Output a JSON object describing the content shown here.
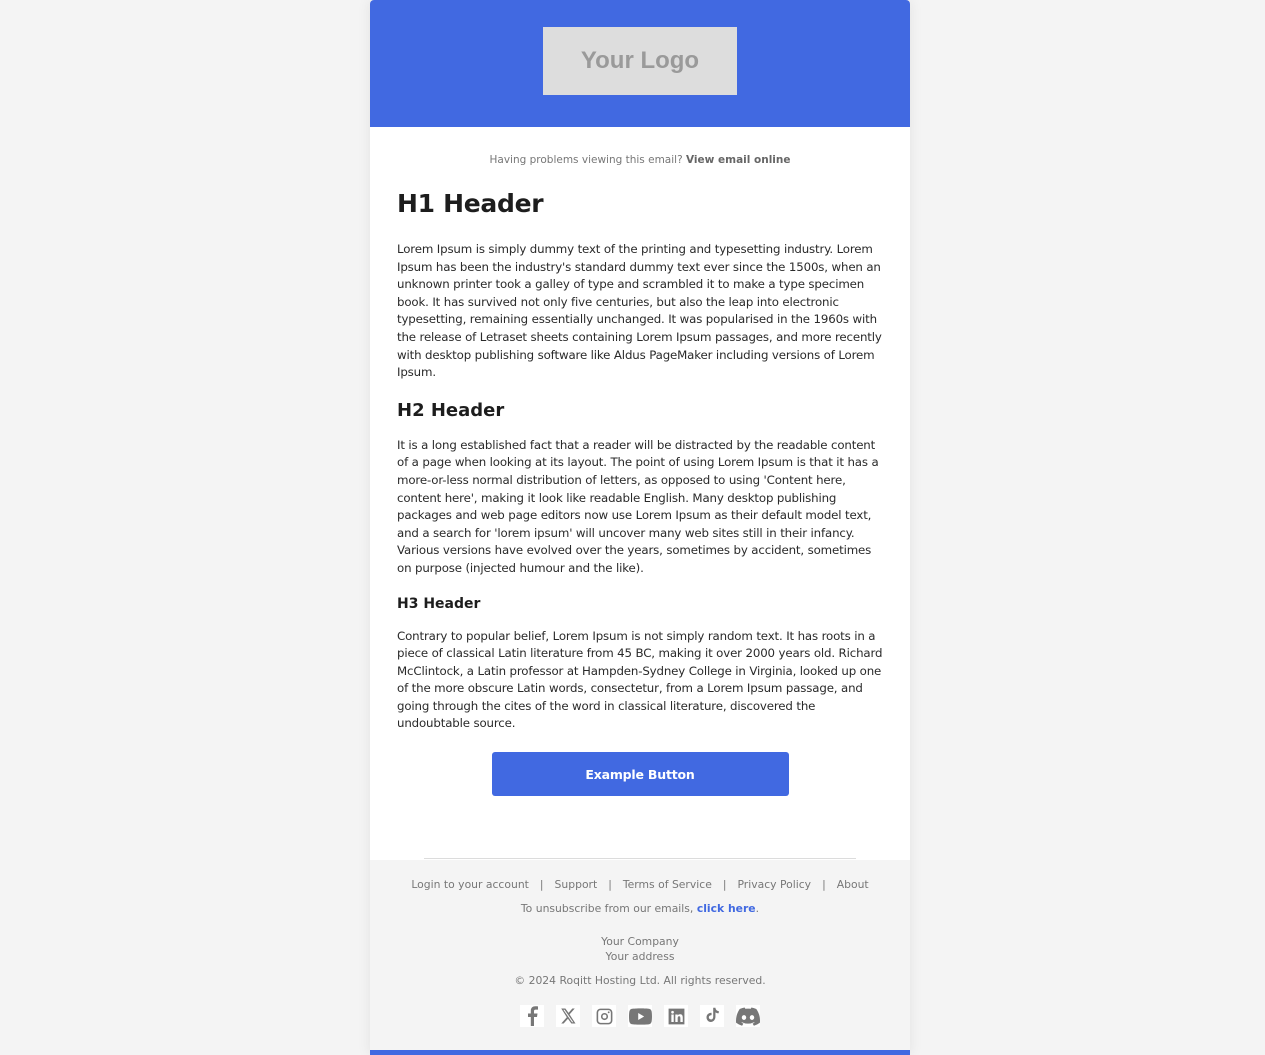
{
  "header": {
    "logo_text": "Your Logo"
  },
  "preheader": {
    "text": "Having problems viewing this email? ",
    "link": "View email online"
  },
  "content": {
    "h1": "H1 Header",
    "p1": "Lorem Ipsum is simply dummy text of the printing and typesetting industry. Lorem Ipsum has been the industry's standard dummy text ever since the 1500s, when an unknown printer took a galley of type and scrambled it to make a type specimen book. It has survived not only five centuries, but also the leap into electronic typesetting, remaining essentially unchanged. It was popularised in the 1960s with the release of Letraset sheets containing Lorem Ipsum passages, and more recently with desktop publishing software like Aldus PageMaker including versions of Lorem Ipsum.",
    "h2": "H2 Header",
    "p2": "It is a long established fact that a reader will be distracted by the readable content of a page when looking at its layout. The point of using Lorem Ipsum is that it has a more-or-less normal distribution of letters, as opposed to using 'Content here, content here', making it look like readable English. Many desktop publishing packages and web page editors now use Lorem Ipsum as their default model text, and a search for 'lorem ipsum' will uncover many web sites still in their infancy. Various versions have evolved over the years, sometimes by accident, sometimes on purpose (injected humour and the like).",
    "h3": "H3 Header",
    "p3": "Contrary to popular belief, Lorem Ipsum is not simply random text. It has roots in a piece of classical Latin literature from 45 BC, making it over 2000 years old. Richard McClintock, a Latin professor at Hampden-Sydney College in Virginia, looked up one of the more obscure Latin words, consectetur, from a Lorem Ipsum passage, and going through the cites of the word in classical literature, discovered the undoubtable source.",
    "button_label": "Example Button"
  },
  "footer": {
    "links": [
      "Login to your account",
      "Support",
      "Terms of Service",
      "Privacy Policy",
      "About"
    ],
    "separator": "|",
    "unsubscribe_text": "To unsubscribe from our emails, ",
    "unsubscribe_link": "click here",
    "unsubscribe_end": ".",
    "company": "Your Company",
    "address": "Your address",
    "copyright": "© 2024 Roqitt Hosting Ltd. All rights reserved.",
    "social": [
      "facebook",
      "x",
      "instagram",
      "youtube",
      "linkedin",
      "tiktok",
      "discord"
    ]
  },
  "colors": {
    "brand": "#4169e1",
    "page_bg": "#f4f4f4",
    "logo_bg": "#dddddd",
    "muted_text": "#777777"
  }
}
